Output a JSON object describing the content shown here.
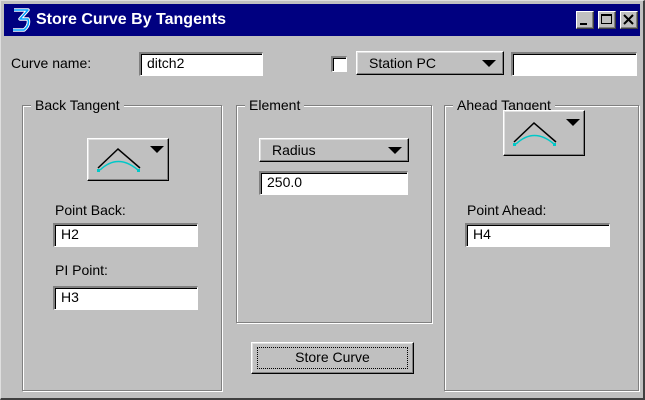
{
  "window": {
    "title": "Store Curve By Tangents",
    "icon": "bentley-app-icon",
    "controls": [
      "minimize-icon",
      "maximize-icon",
      "close-icon"
    ]
  },
  "curve_name": {
    "label": "Curve name:",
    "value": "ditch2"
  },
  "station": {
    "checked": false,
    "selected": "Station PC",
    "value": ""
  },
  "back_tangent": {
    "title": "Back Tangent",
    "picker_icon": "curve-tangent-icon",
    "point_back_label": "Point Back:",
    "point_back_value": "H2",
    "pi_point_label": "PI Point:",
    "pi_point_value": "H3"
  },
  "element": {
    "title": "Element",
    "selected": "Radius",
    "value": "250.0"
  },
  "ahead_tangent": {
    "title": "Ahead Tangent",
    "picker_icon": "curve-tangent-icon",
    "point_ahead_label": "Point Ahead:",
    "point_ahead_value": "H4"
  },
  "store_button": {
    "label": "Store Curve"
  },
  "colors": {
    "titlebar": "#000080",
    "face": "#c0c0c0",
    "curve_accent": "#00c0c0"
  }
}
